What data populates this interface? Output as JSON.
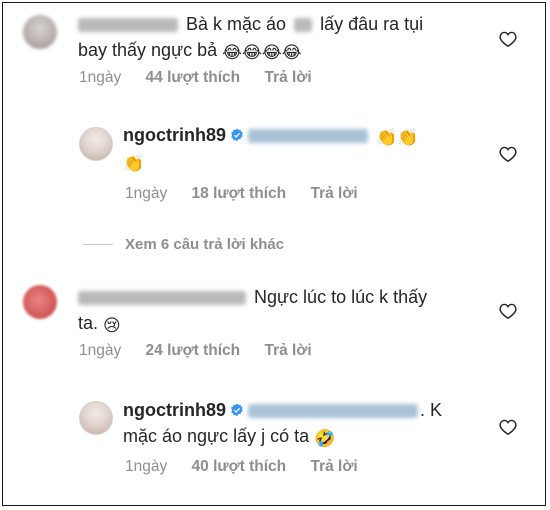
{
  "comments": [
    {
      "text_line1": "Bà k mặc áo",
      "text_line1b": "lấy đâu ra tụi",
      "text_line2": "bay thấy ngực bả",
      "emojis": "😂😂😂😂",
      "age": "1ngày",
      "likes": "44 lượt thích",
      "reply": "Trả lời"
    },
    {
      "username": "ngoctrinh89",
      "emojis_line1": "👏👏",
      "emojis_line2": "👏",
      "age": "1ngày",
      "likes": "18 lượt thích",
      "reply": "Trả lời"
    },
    {
      "text_line1": "Ngực lúc to lúc k thấy",
      "text_line2": "ta.",
      "emoji": "😢",
      "age": "1ngày",
      "likes": "24 lượt thích",
      "reply": "Trả lời"
    },
    {
      "username": "ngoctrinh89",
      "text_line1": ". K",
      "text_line2": "mặc áo ngực lấy j có ta",
      "emoji": "🤣",
      "age": "1ngày",
      "likes": "40 lượt thích",
      "reply": "Trả lời"
    }
  ],
  "view_more": "Xem 6 câu trả lời khác",
  "colors": {
    "text": "#262626",
    "muted": "#8e8e8e",
    "verified": "#3897f0"
  },
  "icons": [
    "heart-icon",
    "verified-badge-icon"
  ]
}
